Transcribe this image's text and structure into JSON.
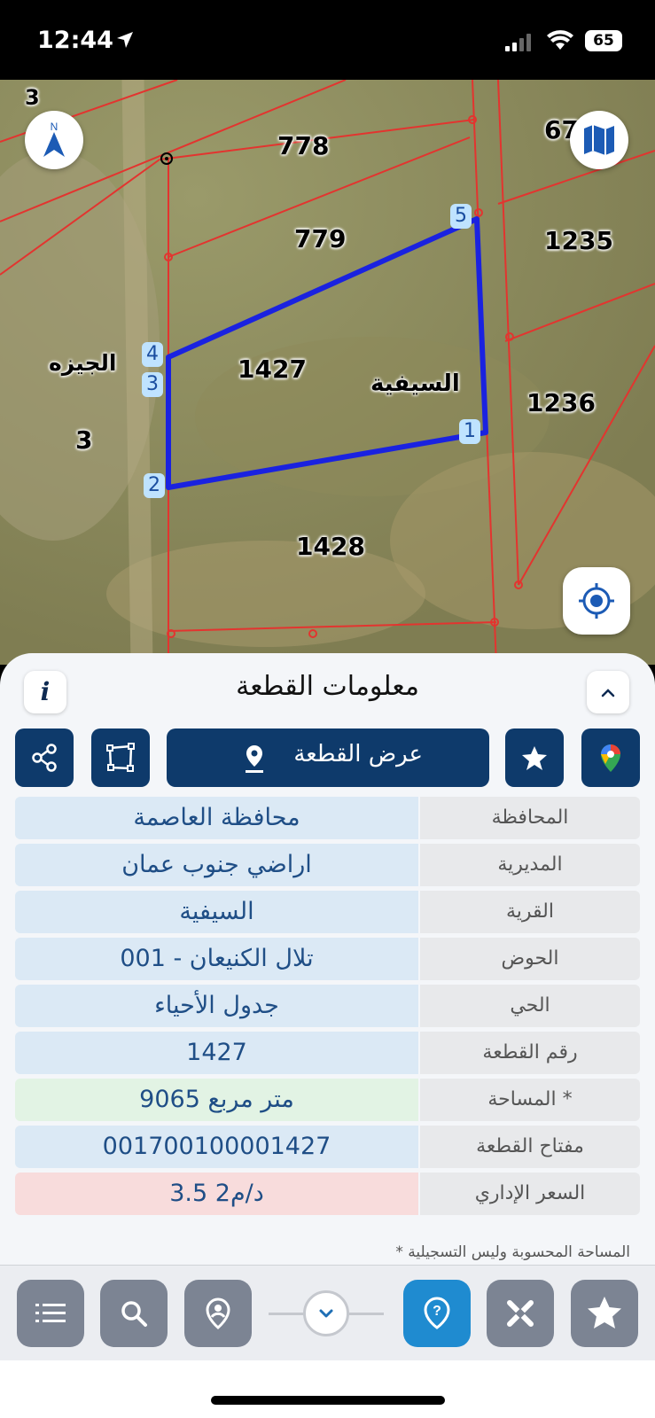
{
  "status": {
    "time": "12:44",
    "battery": "65"
  },
  "map": {
    "parcel_numbers": [
      "778",
      "779",
      "1235",
      "1427",
      "1236",
      "1428",
      "3",
      "3",
      "67"
    ],
    "place_names": [
      "الجيزه",
      "السيفية"
    ],
    "vertices": [
      "1",
      "2",
      "3",
      "4",
      "5"
    ]
  },
  "panel": {
    "title": "معلومات القطعة",
    "view_parcel_label": "عرض القطعة",
    "rows": [
      {
        "label": "المحافظة",
        "value": "محافظة العاصمة"
      },
      {
        "label": "المديرية",
        "value": "اراضي جنوب عمان"
      },
      {
        "label": "القرية",
        "value": "السيفية"
      },
      {
        "label": "الحوض",
        "value": "تلال الكنيعان - 001"
      },
      {
        "label": "الحي",
        "value": "جدول الأحياء"
      },
      {
        "label": "رقم القطعة",
        "value": "1427"
      },
      {
        "label": "المساحة *",
        "value": "9065  متر مربع"
      },
      {
        "label": "مفتاح القطعة",
        "value": "001700100001427"
      },
      {
        "label": "السعر الإداري",
        "value": "3.5 د/م2"
      }
    ],
    "footnote": "* المساحة المحسوبة وليس التسجيلية"
  },
  "icons": {
    "compass": "compass-north-icon",
    "map_layers": "map-icon",
    "locate": "locate-icon",
    "info": "info-icon",
    "collapse": "chevron-up-icon",
    "share": "share-icon",
    "polygon": "polygon-icon",
    "pin": "location-pin-icon",
    "star": "star-icon",
    "google_maps": "google-maps-icon",
    "list": "list-icon",
    "search": "search-icon",
    "place": "place-pin-icon",
    "chevron_down": "chevron-down-icon",
    "help": "help-pin-icon",
    "tools": "tools-icon",
    "favorite": "star-icon"
  },
  "colors": {
    "accent": "#0e3a6b",
    "active": "#1f8bd0",
    "parcel_outline": "#1a22e0",
    "boundary": "#e3342f"
  }
}
